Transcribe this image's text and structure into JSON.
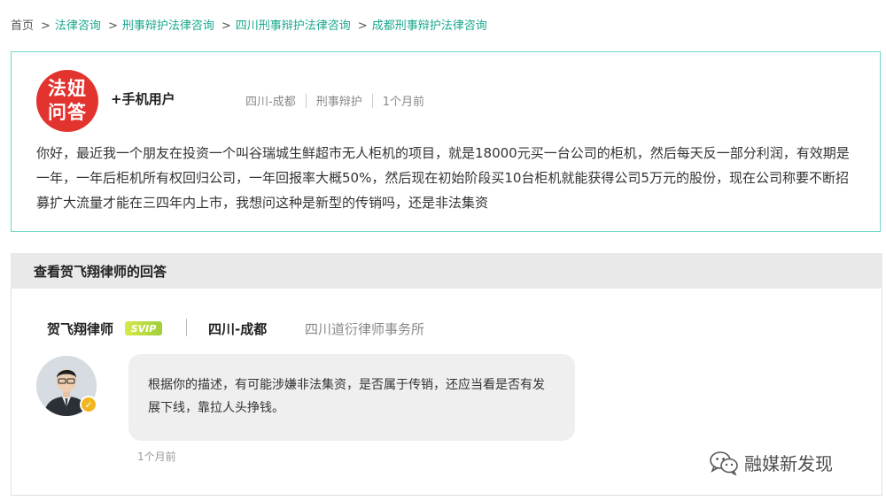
{
  "breadcrumb": {
    "home": "首页",
    "sep": ">",
    "items": [
      "法律咨询",
      "刑事辩护法律咨询",
      "四川刑事辩护法律咨询",
      "成都刑事辩护法律咨询"
    ]
  },
  "question": {
    "logo_text_line1": "法妞",
    "logo_text_line2": "问答",
    "asker": "+手机用户",
    "location": "四川-成都",
    "category": "刑事辩护",
    "time": "1个月前",
    "text": "你好，最近我一个朋友在投资一个叫谷瑞城生鲜超市无人柜机的项目，就是18000元买一台公司的柜机，然后每天反一部分利润，有效期是一年，一年后柜机所有权回归公司，一年回报率大概50%，然后现在初始阶段买10台柜机就能获得公司5万元的股份，现在公司称要不断招募扩大流量才能在三四年内上市，我想问这种是新型的传销吗，还是非法集资"
  },
  "answer": {
    "header": "查看贺飞翔律师的回答",
    "lawyer_name": "贺飞翔律师",
    "badge": "SVIP",
    "location": "四川-成都",
    "firm": "四川道衍律师事务所",
    "text": "根据你的描述，有可能涉嫌非法集资，是否属于传销，还应当看是否有发展下线，靠拉人头挣钱。",
    "time": "1个月前"
  },
  "watermark": {
    "icon": "wechat-icon",
    "text": "融媒新发现"
  },
  "colors": {
    "accent": "#1aa88e",
    "card_border": "#6fd8c5",
    "logo_red": "#e2332f",
    "svip_green": "#9fcf3b"
  }
}
